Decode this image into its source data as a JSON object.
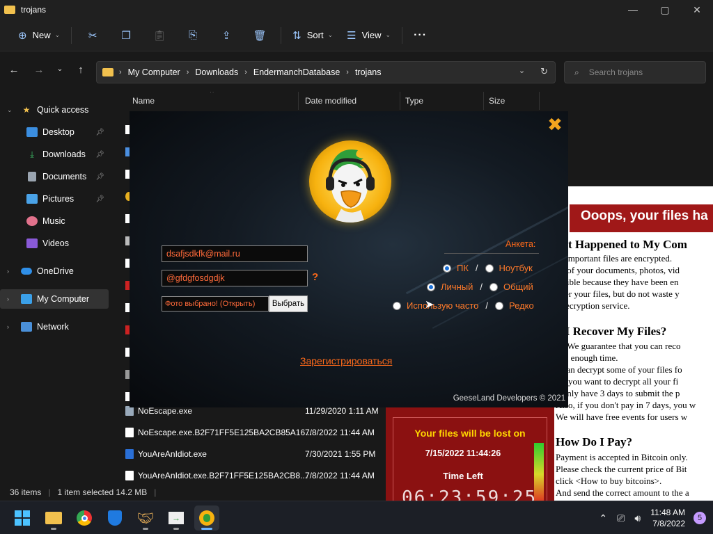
{
  "explorer": {
    "title": "trojans",
    "window_buttons": [
      "—",
      "▢",
      "✕"
    ],
    "toolbar": {
      "new_label": "New",
      "sort_label": "Sort",
      "view_label": "View",
      "more_label": "···"
    },
    "address": {
      "crumbs": [
        "My Computer",
        "Downloads",
        "EndermanchDatabase",
        "trojans"
      ]
    },
    "search": {
      "placeholder": "Search trojans"
    },
    "sidebar": {
      "items": [
        {
          "label": "Quick access"
        },
        {
          "label": "Desktop"
        },
        {
          "label": "Downloads"
        },
        {
          "label": "Documents"
        },
        {
          "label": "Pictures"
        },
        {
          "label": "Music"
        },
        {
          "label": "Videos"
        },
        {
          "label": "OneDrive"
        },
        {
          "label": "My Computer"
        },
        {
          "label": "Network"
        }
      ]
    },
    "columns": {
      "name": "Name",
      "date": "Date modified",
      "type": "Type",
      "size": "Size"
    },
    "files": [
      {
        "name": "NoEscape.exe",
        "date": "11/29/2020 1:11 AM"
      },
      {
        "name": "NoEscape.exe.B2F71FF5E125BA2CB85A16...",
        "date": "7/8/2022 11:44 AM"
      },
      {
        "name": "YouAreAnIdiot.exe",
        "date": "7/30/2021 1:55 PM"
      },
      {
        "name": "YouAreAnIdiot.exe.B2F71FF5E125BA2CB8...",
        "date": "7/8/2022 11:44 AM"
      }
    ],
    "status": {
      "items": "36 items",
      "selected": "1 item selected  14.2 MB"
    }
  },
  "ransom_note": {
    "banner": "Ooops, your files ha",
    "heading1": "hat Happened to My Com",
    "p1": [
      "ur important files are encrypted.",
      "ny of your documents, photos, vid",
      "essible because they have been en",
      "over your files, but do not waste y",
      "r decryption service."
    ],
    "heading2": "n I Recover My Files?",
    "p2": [
      "re. We guarantee that you can reco",
      "t so enough time.",
      "u can decrypt some of your files fo",
      "t if you want to decrypt all your fi",
      "u only have 3 days to submit the p",
      "Also, if you don't pay in 7 days, you w",
      "We will have free events for users w"
    ],
    "heading3": "How Do I Pay?",
    "p3": [
      "Payment is accepted in Bitcoin only.",
      "Please check the current price of Bit",
      "click <How to buy bitcoins>.",
      "And send the correct amount to the a"
    ]
  },
  "timer": {
    "lost_label": "Your files will be lost on",
    "date": "7/15/2022 11:44:26",
    "time_left_label": "Time Left",
    "digits": "06:23:59:25",
    "meter_level": 1.0
  },
  "dialog": {
    "email_value": "dsafjsdkfk@mail.ru",
    "nick_value": "@gfdgfosdgdjk",
    "help_mark": "?",
    "photo_status": "Фото выбрано! (Открыть)",
    "photo_button": "Выбрать",
    "survey_title": "Анкета:",
    "q1": {
      "a": "ПК",
      "b": "Ноутбук",
      "selected": "a"
    },
    "q2": {
      "a": "Личный",
      "b": "Общий",
      "selected": "a"
    },
    "q3": {
      "a": "Использую часто",
      "b": "Редко",
      "selected": "none"
    },
    "slash": "/",
    "register_link": "Зарегистрироваться",
    "credits": "GeeseLand Developers © 2021",
    "close_glyph": "✖",
    "colors": {
      "accent": "#ff6a1a",
      "close": "#f2a51f"
    }
  },
  "taskbar": {
    "time": "11:48 AM",
    "date": "7/8/2022",
    "notification_count": "5"
  }
}
